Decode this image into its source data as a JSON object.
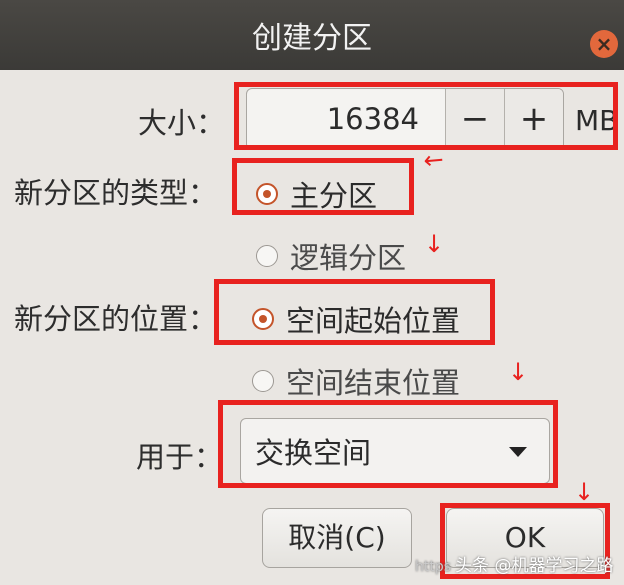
{
  "dialog": {
    "title": "创建分区"
  },
  "size": {
    "label": "大小：",
    "value": "16384",
    "decrement": "−",
    "increment": "+",
    "unit": "MB"
  },
  "type": {
    "label": "新分区的类型：",
    "options": [
      {
        "label": "主分区",
        "selected": true
      },
      {
        "label": "逻辑分区",
        "selected": false
      }
    ]
  },
  "location": {
    "label": "新分区的位置：",
    "options": [
      {
        "label": "空间起始位置",
        "selected": true
      },
      {
        "label": "空间结束位置",
        "selected": false
      }
    ]
  },
  "use_as": {
    "label": "用于：",
    "value": "交换空间"
  },
  "buttons": {
    "cancel": "取消(C)",
    "ok": "OK"
  },
  "annotation": {
    "color": "#e8221f"
  },
  "watermark": {
    "prefix": "https",
    "text": "头条 @机器学习之路"
  }
}
